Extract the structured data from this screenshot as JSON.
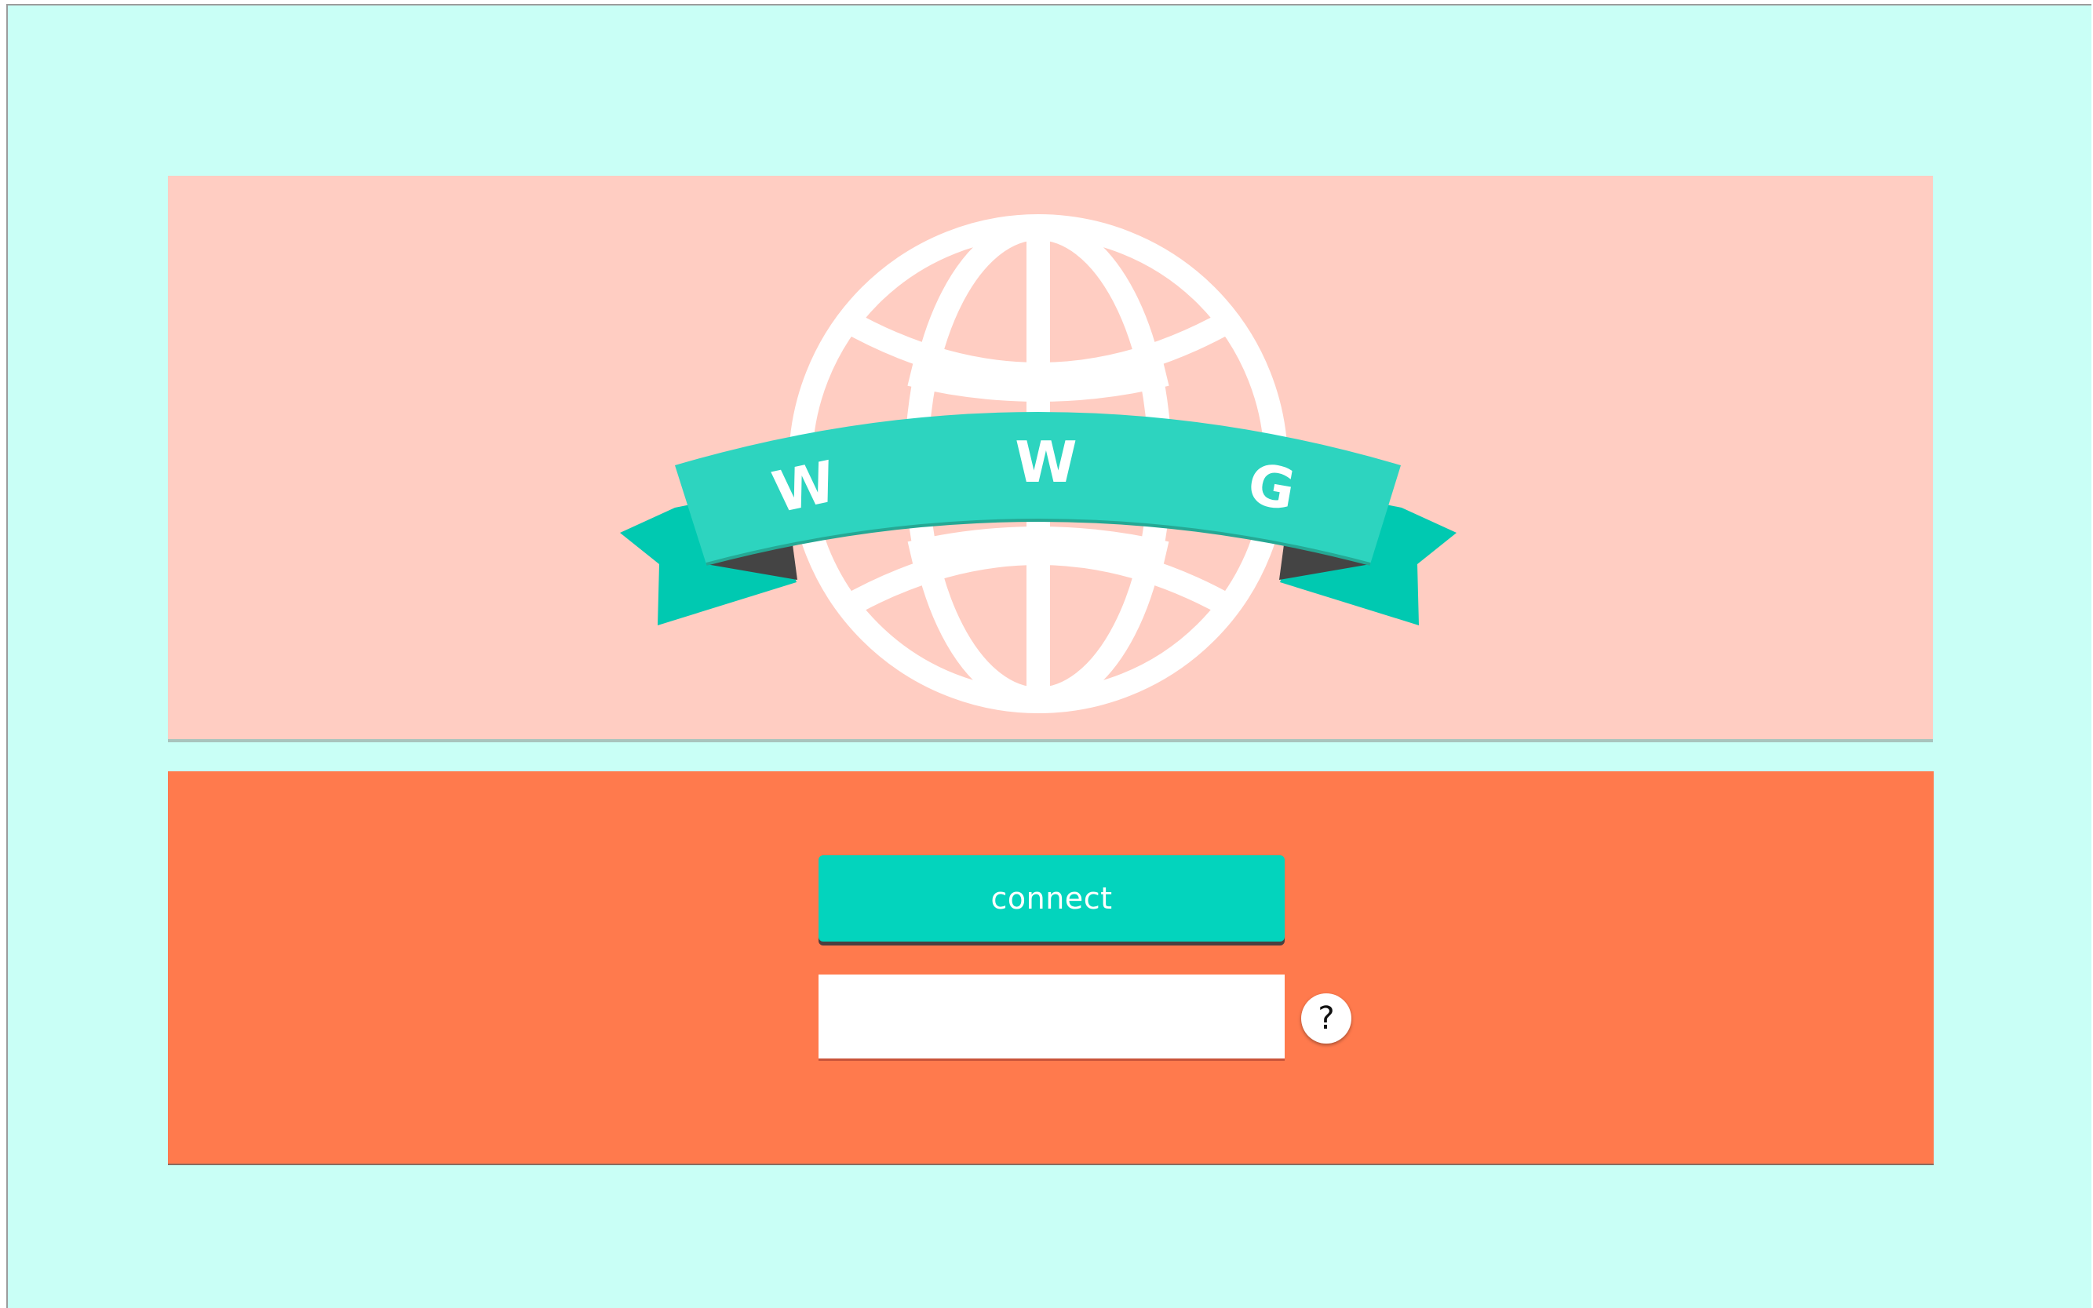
{
  "logo": {
    "letters": [
      "W",
      "W",
      "G"
    ],
    "globe_color": "#ffffff",
    "ribbon_color": "#2dd4bf",
    "ribbon_tail_color": "#00c9b1",
    "ribbon_shadow_color": "#444444"
  },
  "form": {
    "connect_label": "connect",
    "name_value": "",
    "name_placeholder": "",
    "help_label": "?"
  },
  "colors": {
    "background": "#c9fff6",
    "logo_panel": "#ffcdc2",
    "form_panel": "#ff7a4d",
    "accent": "#03d4bd"
  },
  "icons": {
    "logo": "globe-ribbon-icon",
    "help": "question-icon"
  }
}
